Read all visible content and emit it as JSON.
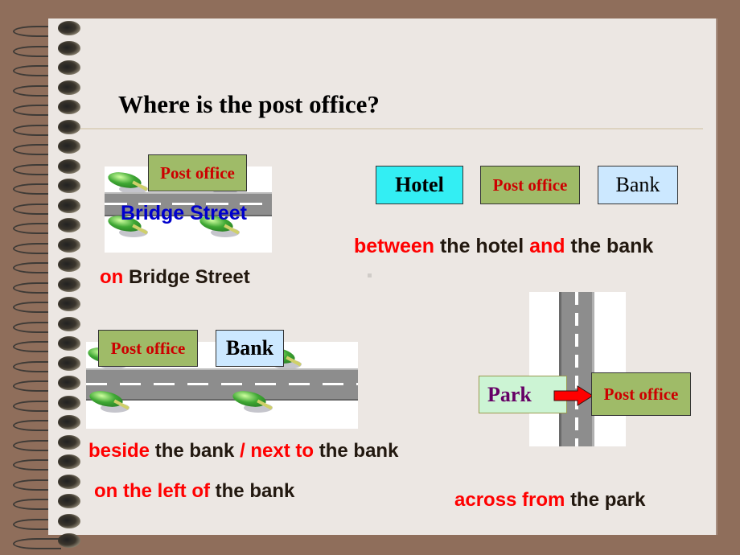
{
  "slide": {
    "title": "Where is the post office?",
    "colors": {
      "background": "#8f6e5b",
      "paper": "#ece7e3",
      "highlight": "#ff0000",
      "text": "#22180f",
      "post_office_fill": "#9fbb68",
      "post_office_text": "#cc0000",
      "hotel_fill": "#33eef3",
      "bank_fill": "#cce8ff",
      "park_fill": "#ccf4d4",
      "park_text": "#660066",
      "street_label": "#0000cc"
    },
    "binding_icon": "spiral-binding-icon"
  },
  "scene_on": {
    "post_office": "Post office",
    "street_label": "Bridge Street",
    "phrase": {
      "highlight": "on",
      "rest": "Bridge Street"
    }
  },
  "scene_between": {
    "hotel": "Hotel",
    "post_office": "Post office",
    "bank": "Bank",
    "phrase": {
      "h1": "between",
      "t1": "the hotel",
      "h2": "and",
      "t2": "the bank"
    }
  },
  "scene_beside": {
    "post_office": "Post office",
    "bank": "Bank",
    "phrase1": {
      "h1": "beside",
      "t1": "the bank",
      "h2": "/ next to",
      "t2": "the bank"
    },
    "phrase2": {
      "highlight": "on the left of",
      "rest": "the bank"
    }
  },
  "scene_across": {
    "park": "Park",
    "post_office": "Post office",
    "arrow_icon": "right-arrow-icon",
    "phrase": {
      "highlight": "across from",
      "rest": "the park"
    }
  }
}
